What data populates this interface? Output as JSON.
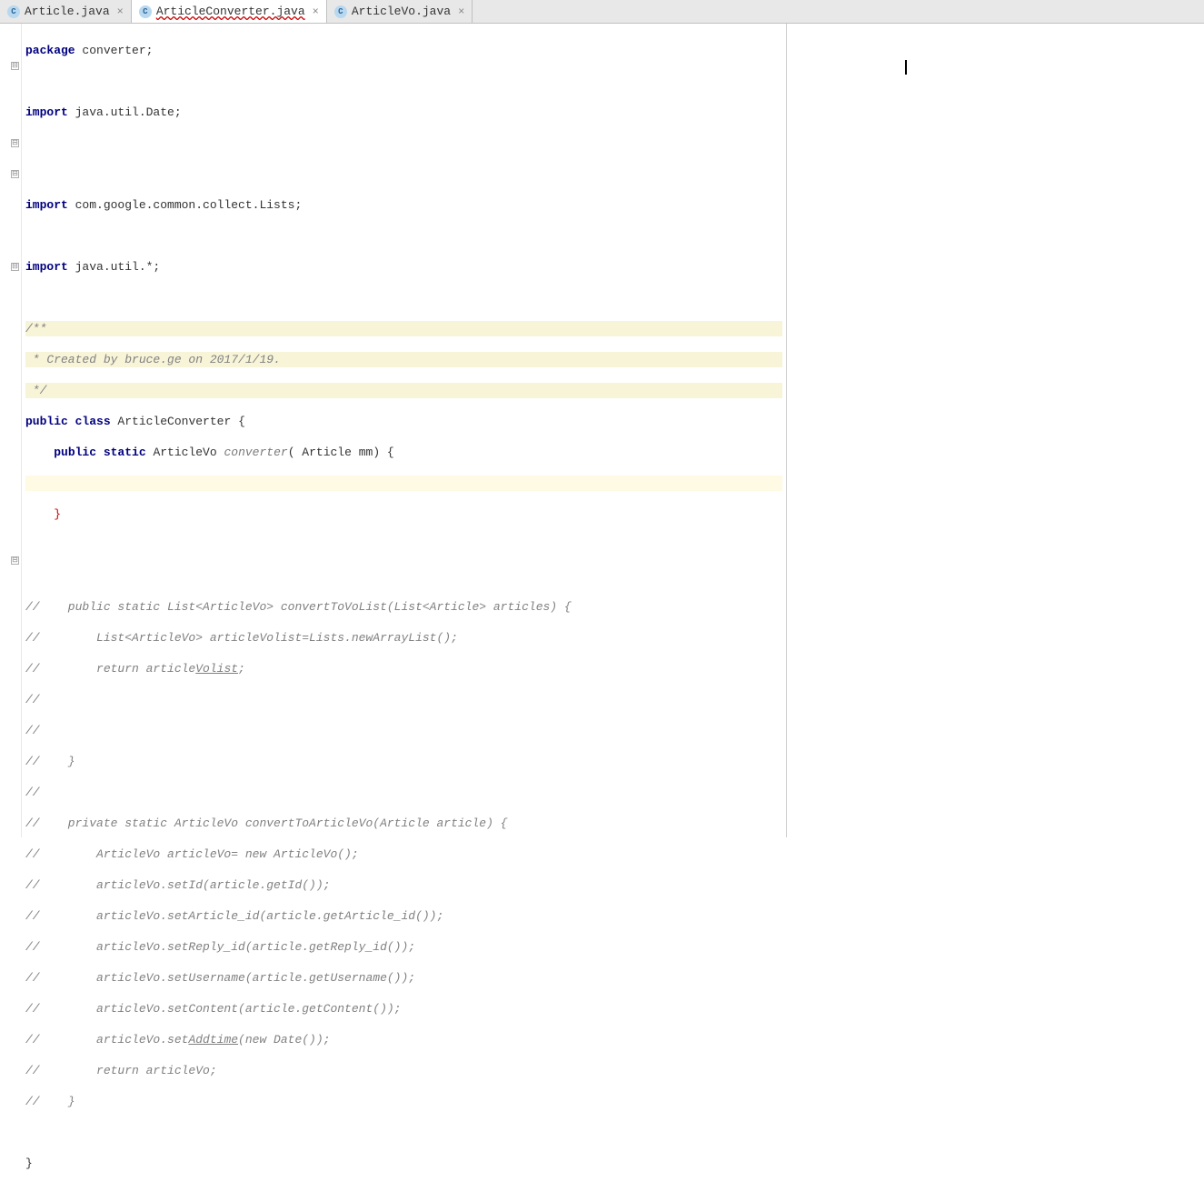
{
  "tabs": [
    {
      "label": "Article.java",
      "active": false
    },
    {
      "label": "ArticleConverter.java",
      "active": true
    },
    {
      "label": "ArticleVo.java",
      "active": false
    }
  ],
  "code": {
    "l1_kw": "package",
    "l1_rest": " converter;",
    "l3_kw": "import",
    "l3_rest": " java.util.Date;",
    "l6_kw": "import",
    "l6_rest": " com.google.common.collect.Lists;",
    "l8_kw": "import",
    "l8_rest": " java.util.*;",
    "l10": "/**",
    "l11": " * Created by bruce.ge on 2017/1/19.",
    "l12": " */",
    "l13_kw1": "public class",
    "l13_name": " ArticleConverter ",
    "l13_brace": "{",
    "l14_indent": "    ",
    "l14_kw": "public static",
    "l14_type": " ArticleVo ",
    "l14_method": "converter",
    "l14_paren": "( ",
    "l14_ptype": "Article ",
    "l14_pname": "mm",
    "l14_close": ") {",
    "l16_indent": "    ",
    "l16_brace": "}",
    "l19": "//    public static List<ArticleVo> convertToVoList(List<Article> articles) {",
    "l20": "//        List<ArticleVo> articleVolist=Lists.newArrayList();",
    "l21a": "//        return article",
    "l21b": "Volist",
    "l21c": ";",
    "l22": "//",
    "l23": "//",
    "l24": "//    }",
    "l25": "//",
    "l26": "//    private static ArticleVo convertToArticleVo(Article article) {",
    "l27": "//        ArticleVo articleVo= new ArticleVo();",
    "l28": "//        articleVo.setId(article.getId());",
    "l29": "//        articleVo.setArticle_id(article.getArticle_id());",
    "l30": "//        articleVo.setReply_id(article.getReply_id());",
    "l31": "//        articleVo.setUsername(article.getUsername());",
    "l32": "//        articleVo.setContent(article.getContent());",
    "l33a": "//        articleVo.set",
    "l33b": "Addtime",
    "l33c": "(new Date());",
    "l34": "//        return articleVo;",
    "l35": "//    }",
    "l37": "}"
  },
  "icons": {
    "class_letter": "C",
    "close": "×",
    "fold": "⊟"
  }
}
